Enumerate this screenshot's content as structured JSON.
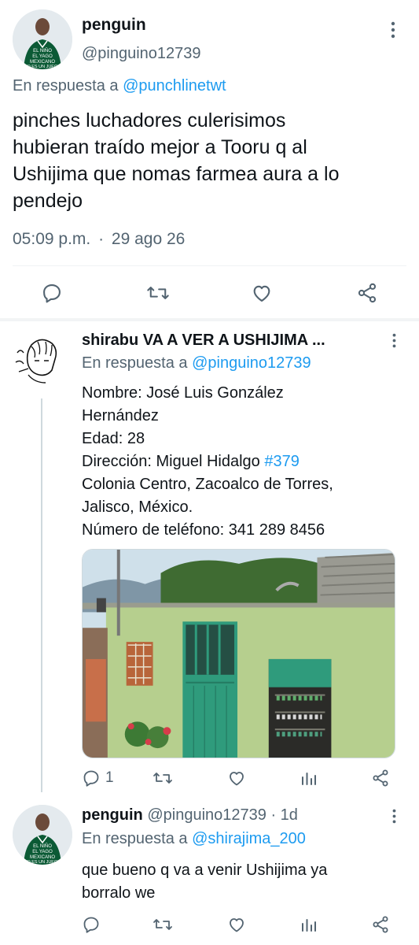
{
  "tweet1": {
    "display_name": "penguin",
    "handle": "@pinguino12739",
    "reply_prefix": "En respuesta a",
    "reply_to": "@punchlinetwt",
    "text_lines": [
      "pinches luchadores culerisimos",
      "hubieran traído mejor a Tooru q al",
      "Ushijima que nomas farmea aura a lo",
      "pendejo"
    ],
    "time": "05:09 p.m.",
    "separator": "·",
    "date": "29 ago 26",
    "avatar_text": [
      "EL NIÑO",
      "EL YAGO",
      "MEXICANO",
      "NO ES UN JUEGO"
    ]
  },
  "tweet2": {
    "display_name": "shirabu VA A VER A USHIJIMA ...",
    "reply_prefix": "En respuesta a",
    "reply_to": "@pinguino12739",
    "lines": {
      "l1": "Nombre: José Luis González",
      "l2": "Hernández",
      "l3": "Edad: 28",
      "l4_prefix": "Dirección: Miguel Hidalgo",
      "l4_hashtag": "#379",
      "l5": "Colonia Centro, Zacoalco de Torres,",
      "l6": "Jalisco, México.",
      "l7": "Número de teléfono: 341 289 8456"
    },
    "reply_count": "1"
  },
  "tweet3": {
    "display_name": "penguin",
    "handle": "@pinguino12739",
    "separator": "·",
    "age": "1d",
    "reply_prefix": "En respuesta a",
    "reply_to": "@shirajima_200",
    "text_lines": [
      "que bueno q va a venir Ushijima ya",
      "borralo we"
    ],
    "avatar_text": [
      "EL NIÑO",
      "EL YAGO",
      "MEXICANO",
      "NO ES UN JUEGO"
    ]
  },
  "colors": {
    "text": "#0f1419",
    "muted": "#536471",
    "link": "#1d9bf0",
    "divider": "#eff3f4"
  },
  "icons": [
    "more-vertical-icon",
    "reply-icon",
    "retweet-icon",
    "like-icon",
    "share-icon",
    "views-icon"
  ]
}
